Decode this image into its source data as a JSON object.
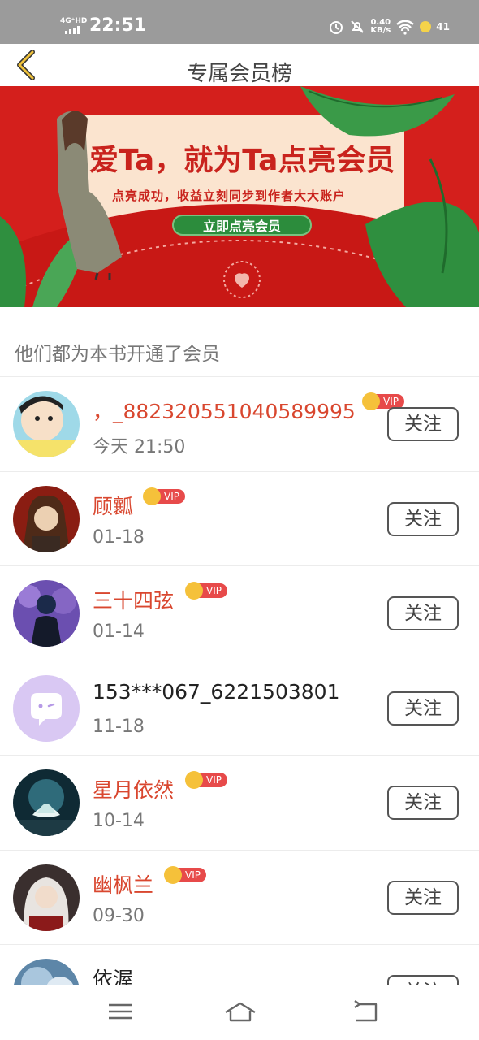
{
  "status_bar": {
    "network": "4G⁺HD",
    "time": "22:51",
    "speed_value": "0.40",
    "speed_unit": "KB/s",
    "battery": "41"
  },
  "header": {
    "title": "专属会员榜"
  },
  "banner": {
    "headline": "爱Ta，就为Ta点亮会员",
    "subtitle": "点亮成功，收益立刻同步到作者大大账户",
    "cta": "立即点亮会员"
  },
  "section": {
    "label": "他们都为本书开通了会员"
  },
  "members": [
    {
      "name": "，_882320551040589995",
      "date": "今天 21:50",
      "vip": true,
      "follow": "关注"
    },
    {
      "name": "顾瓤",
      "date": "01-18",
      "vip": true,
      "follow": "关注"
    },
    {
      "name": "三十四弦",
      "date": "01-14",
      "vip": true,
      "follow": "关注"
    },
    {
      "name": "153***067_6221503801",
      "date": "11-18",
      "vip": false,
      "follow": "关注"
    },
    {
      "name": "星月依然",
      "date": "10-14",
      "vip": true,
      "follow": "关注"
    },
    {
      "name": "幽枫兰",
      "date": "09-30",
      "vip": true,
      "follow": "关注"
    },
    {
      "name": "依渥",
      "date": "",
      "vip": false,
      "follow": "关注"
    }
  ],
  "vip_badge_text": "VIP",
  "colors": {
    "accent_red": "#d9472f",
    "banner_red": "#d41f1c",
    "cta_green": "#2c8c3c",
    "status_bar": "#9b9b9b"
  }
}
